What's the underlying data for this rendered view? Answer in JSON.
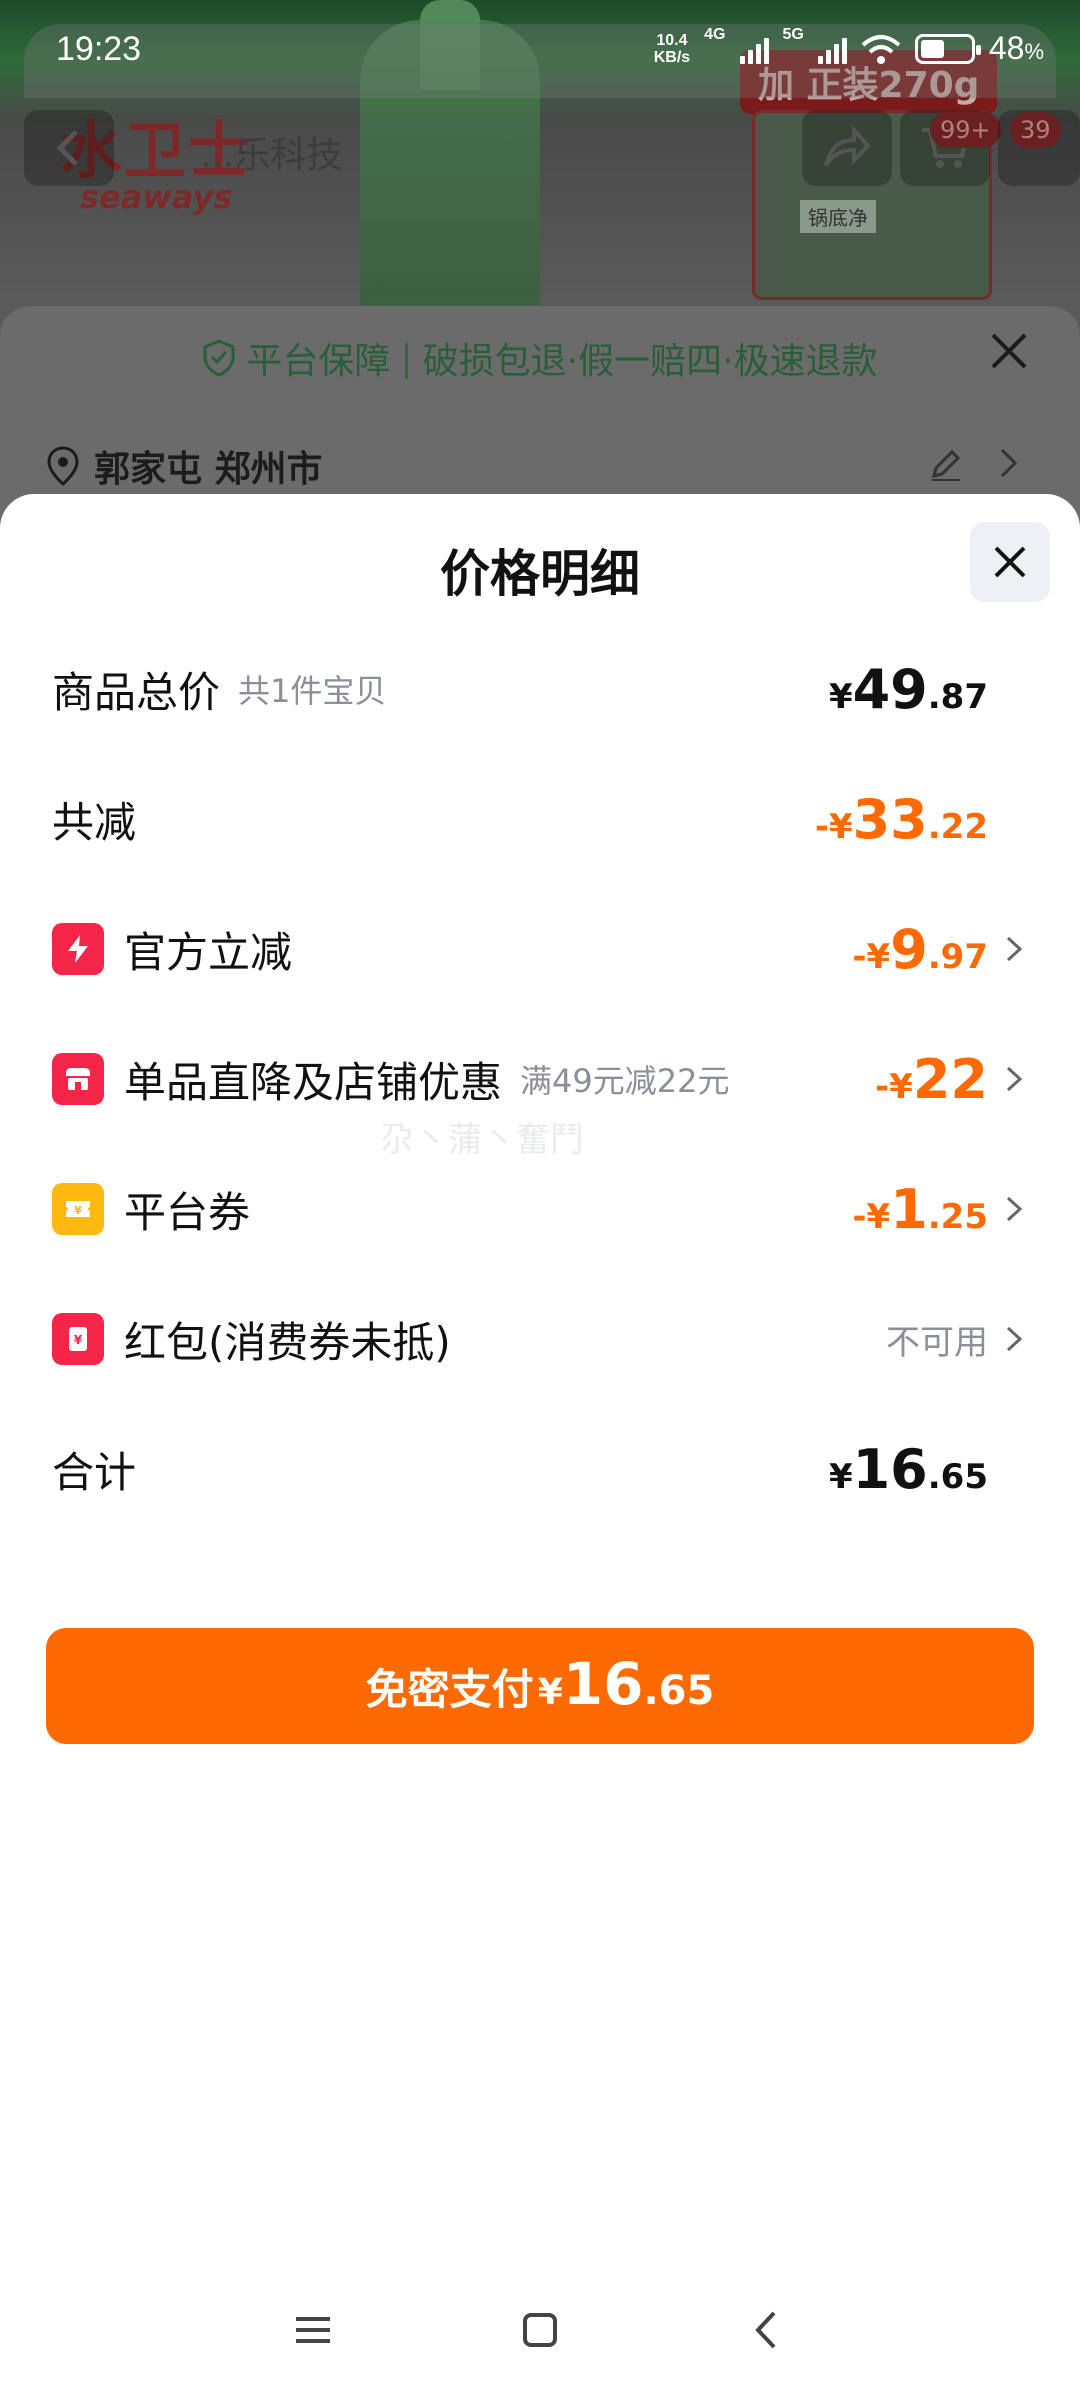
{
  "status_bar": {
    "time": "19:23",
    "speed_value": "10.4",
    "speed_unit": "KB/s",
    "net1": "4G",
    "net2": "5G",
    "battery": "48",
    "battery_unit": "%",
    "battery_level": 0.48
  },
  "background": {
    "logo": "水卫士",
    "logo_sub": "seaways",
    "promo": "加 正装270g",
    "thumb_label": "锅底净",
    "nav_title": "...乐科技",
    "cart_badge": "99+",
    "msg_badge": "39",
    "guarantee": {
      "main": "平台保障",
      "items": "破损包退·假一赔四·极速退款"
    },
    "address": "郭家屯 郑州市"
  },
  "sheet": {
    "title": "价格明细",
    "rows": {
      "total": {
        "label": "商品总价",
        "sub": "共1件宝贝",
        "sym": "¥",
        "int": "49",
        "dec": ".87"
      },
      "reduce": {
        "label": "共减",
        "sym": "-¥",
        "int": "33",
        "dec": ".22"
      },
      "official": {
        "label": "官方立减",
        "sym": "-¥",
        "int": "9",
        "dec": ".97"
      },
      "shop": {
        "label": "单品直降及店铺优惠",
        "sub": "满49元减22元",
        "sym": "-¥",
        "int": "22",
        "dec": ""
      },
      "coupon": {
        "label": "平台券",
        "sym": "-¥",
        "int": "1",
        "dec": ".25"
      },
      "redpacket": {
        "label": "红包(消费券未抵)",
        "value": "不可用"
      },
      "sum": {
        "label": "合计",
        "sym": "¥",
        "int": "16",
        "dec": ".65"
      }
    },
    "watermark": "尕丶蒲丶奮鬥",
    "pay_button": {
      "label": "免密支付",
      "sym": "¥",
      "int": "16",
      "dec": ".65"
    }
  },
  "colors": {
    "accent": "#ff6a00",
    "icon_red": "#f5254a",
    "icon_yellow": "#ffb80f",
    "muted": "#8a8f99"
  },
  "icons": [
    "back-icon",
    "share-icon",
    "cart-icon",
    "shield-icon",
    "close-icon",
    "location-pin-icon",
    "edit-icon",
    "chevron-right-icon",
    "lightning-icon",
    "shop-icon",
    "coupon-icon",
    "red-packet-icon",
    "menu-icon",
    "home-icon",
    "nav-back-icon"
  ]
}
